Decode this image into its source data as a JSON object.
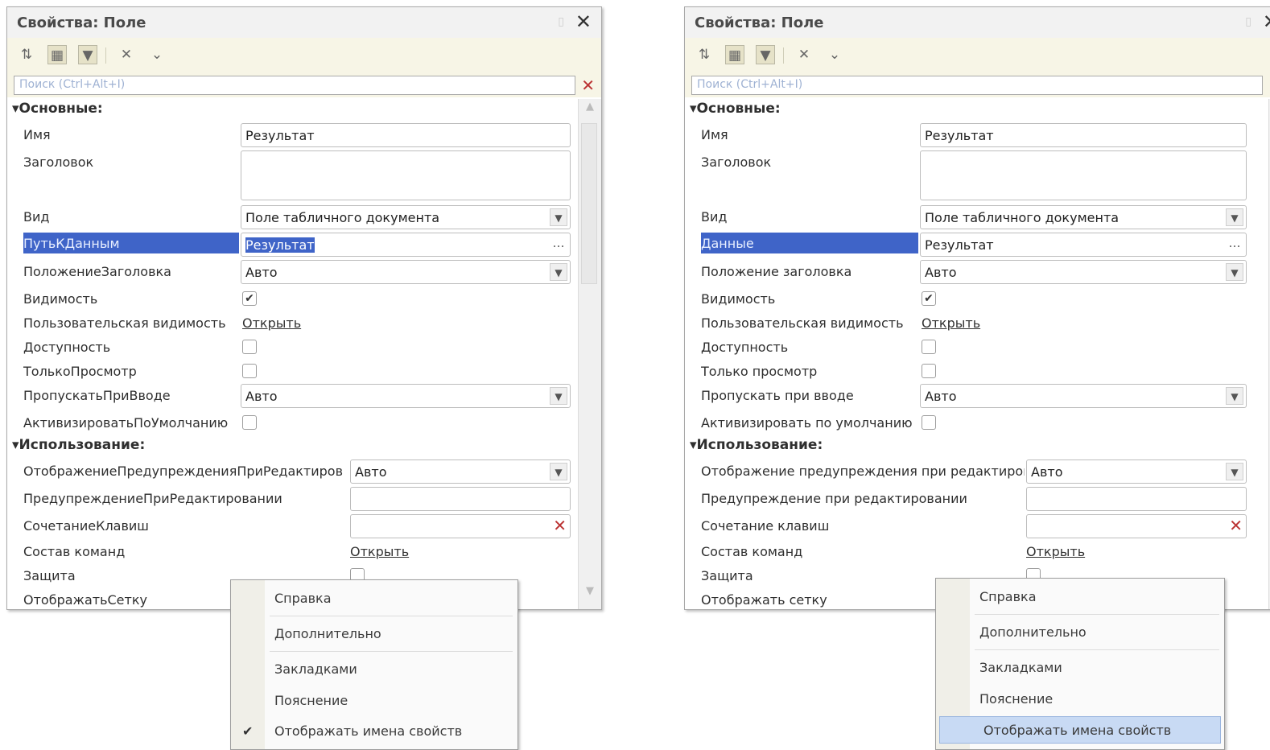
{
  "left": {
    "title": "Свойства: Поле",
    "search_placeholder": "Поиск (Ctrl+Alt+I)",
    "groups": {
      "main": "Основные:",
      "usage": "Использование:"
    },
    "props": {
      "name": {
        "label": "Имя",
        "value": "Результат"
      },
      "caption": {
        "label": "Заголовок",
        "value": ""
      },
      "kind": {
        "label": "Вид",
        "value": "Поле табличного документа"
      },
      "data": {
        "label": "ПутьКДанным",
        "value": "Результат"
      },
      "title_pos": {
        "label": "ПоложениеЗаголовка",
        "value": "Авто"
      },
      "visible": {
        "label": "Видимость",
        "checked": true
      },
      "user_vis": {
        "label": "Пользовательская видимость",
        "link": "Открыть"
      },
      "enabled": {
        "label": "Доступность",
        "checked": false
      },
      "readonly": {
        "label": "ТолькоПросмотр",
        "checked": false
      },
      "skip": {
        "label": "ПропускатьПриВводе",
        "value": "Авто"
      },
      "activate": {
        "label": "АктивизироватьПоУмолчанию",
        "checked": false
      },
      "warn_disp": {
        "label": "ОтображениеПредупрежденияПриРедактиров",
        "value": "Авто"
      },
      "warn": {
        "label": "ПредупреждениеПриРедактировании",
        "value": ""
      },
      "shortcut": {
        "label": "СочетаниеКлавиш",
        "value": ""
      },
      "commands": {
        "label": "Состав команд",
        "link": "Открыть"
      },
      "protect": {
        "label": "Защита",
        "checked": false
      },
      "grid": {
        "label": "ОтображатьСетку"
      }
    },
    "menu": [
      "Справка",
      "Дополнительно",
      "Закладками",
      "Пояснение",
      "Отображать имена свойств"
    ]
  },
  "right": {
    "title": "Свойства: Поле",
    "search_placeholder": "Поиск (Ctrl+Alt+I)",
    "groups": {
      "main": "Основные:",
      "usage": "Использование:"
    },
    "props": {
      "name": {
        "label": "Имя",
        "value": "Результат"
      },
      "caption": {
        "label": "Заголовок",
        "value": ""
      },
      "kind": {
        "label": "Вид",
        "value": "Поле табличного документа"
      },
      "data": {
        "label": "Данные",
        "value": "Результат"
      },
      "title_pos": {
        "label": "Положение заголовка",
        "value": "Авто"
      },
      "visible": {
        "label": "Видимость",
        "checked": true
      },
      "user_vis": {
        "label": "Пользовательская видимость",
        "link": "Открыть"
      },
      "enabled": {
        "label": "Доступность",
        "checked": false
      },
      "readonly": {
        "label": "Только просмотр",
        "checked": false
      },
      "skip": {
        "label": "Пропускать при вводе",
        "value": "Авто"
      },
      "activate": {
        "label": "Активизировать по умолчанию",
        "checked": false
      },
      "warn_disp": {
        "label": "Отображение предупреждения при редактиров",
        "value": "Авто"
      },
      "warn": {
        "label": "Предупреждение при редактировании",
        "value": ""
      },
      "shortcut": {
        "label": "Сочетание клавиш",
        "value": ""
      },
      "commands": {
        "label": "Состав команд",
        "link": "Открыть"
      },
      "protect": {
        "label": "Защита",
        "checked": false
      },
      "grid": {
        "label": "Отображать сетку"
      }
    },
    "menu": [
      "Справка",
      "Дополнительно",
      "Закладками",
      "Пояснение",
      "Отображать имена свойств"
    ]
  },
  "icons": {
    "sort": "sort-az-icon",
    "categories": "categories-icon",
    "filter": "filter-icon",
    "clear": "clear-icon",
    "more": "chevron-down-icon",
    "close": "close-icon",
    "checkmark": "checkmark-icon"
  }
}
